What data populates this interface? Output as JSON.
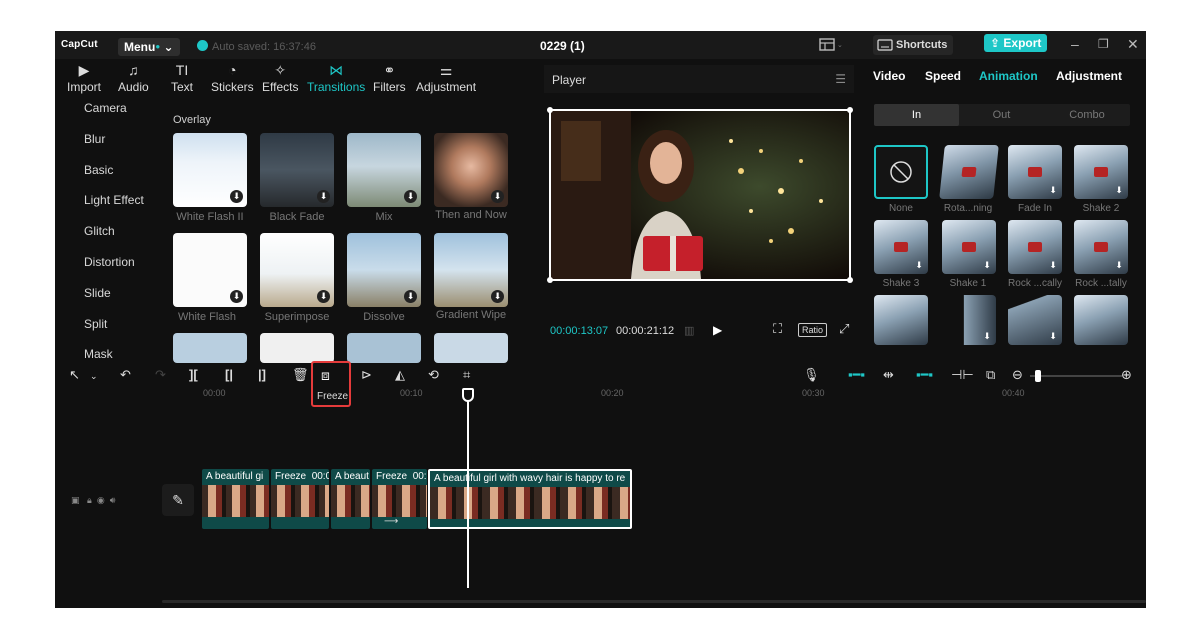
{
  "app": {
    "logo": "CapCut",
    "menu_label": "Menu",
    "autosave": "Auto saved: 16:37:46",
    "project_title": "0229 (1)",
    "shortcuts_label": "Shortcuts",
    "export_label": "Export"
  },
  "tool_tabs": [
    {
      "label": "Import",
      "icon": "import-icon"
    },
    {
      "label": "Audio",
      "icon": "audio-icon"
    },
    {
      "label": "Text",
      "icon": "text-icon"
    },
    {
      "label": "Stickers",
      "icon": "stickers-icon"
    },
    {
      "label": "Effects",
      "icon": "effects-icon"
    },
    {
      "label": "Transitions",
      "icon": "transitions-icon",
      "active": true
    },
    {
      "label": "Filters",
      "icon": "filters-icon"
    },
    {
      "label": "Adjustment",
      "icon": "adjustment-icon"
    }
  ],
  "categories": [
    "Camera",
    "Blur",
    "Basic",
    "Light Effect",
    "Glitch",
    "Distortion",
    "Slide",
    "Split",
    "Mask"
  ],
  "transitions": {
    "section_title": "Overlay",
    "items": [
      "White Flash II",
      "Black Fade",
      "Mix",
      "Then and Now",
      "White Flash",
      "Superimpose",
      "Dissolve",
      "Gradient Wipe"
    ]
  },
  "player": {
    "title": "Player",
    "current_time": "00:00:13:07",
    "total_time": "00:00:21:12",
    "ratio_label": "Ratio"
  },
  "right_panel": {
    "tabs": [
      "Video",
      "Speed",
      "Animation",
      "Adjustment"
    ],
    "active_tab": "Animation",
    "segments": [
      "In",
      "Out",
      "Combo"
    ],
    "animations": [
      "None",
      "Rota...ning",
      "Fade In",
      "Shake 2",
      "Shake 3",
      "Shake 1",
      "Rock ...cally",
      "Rock ...tally"
    ]
  },
  "toolbar": {
    "freeze_label": "Freeze"
  },
  "timeline": {
    "ticks": [
      "00:00",
      "00:10",
      "00:20",
      "00:30",
      "00:40"
    ],
    "clips": [
      "A beautiful gi",
      "Freeze",
      "00:0",
      "A beaut",
      "Freeze",
      "00:",
      "A beautiful girl with wavy hair is happy to re"
    ]
  },
  "colors": {
    "accent": "#1ec7c7",
    "background": "#101010",
    "clip": "#0f4a48",
    "freeze_highlight": "#e53b3b"
  }
}
